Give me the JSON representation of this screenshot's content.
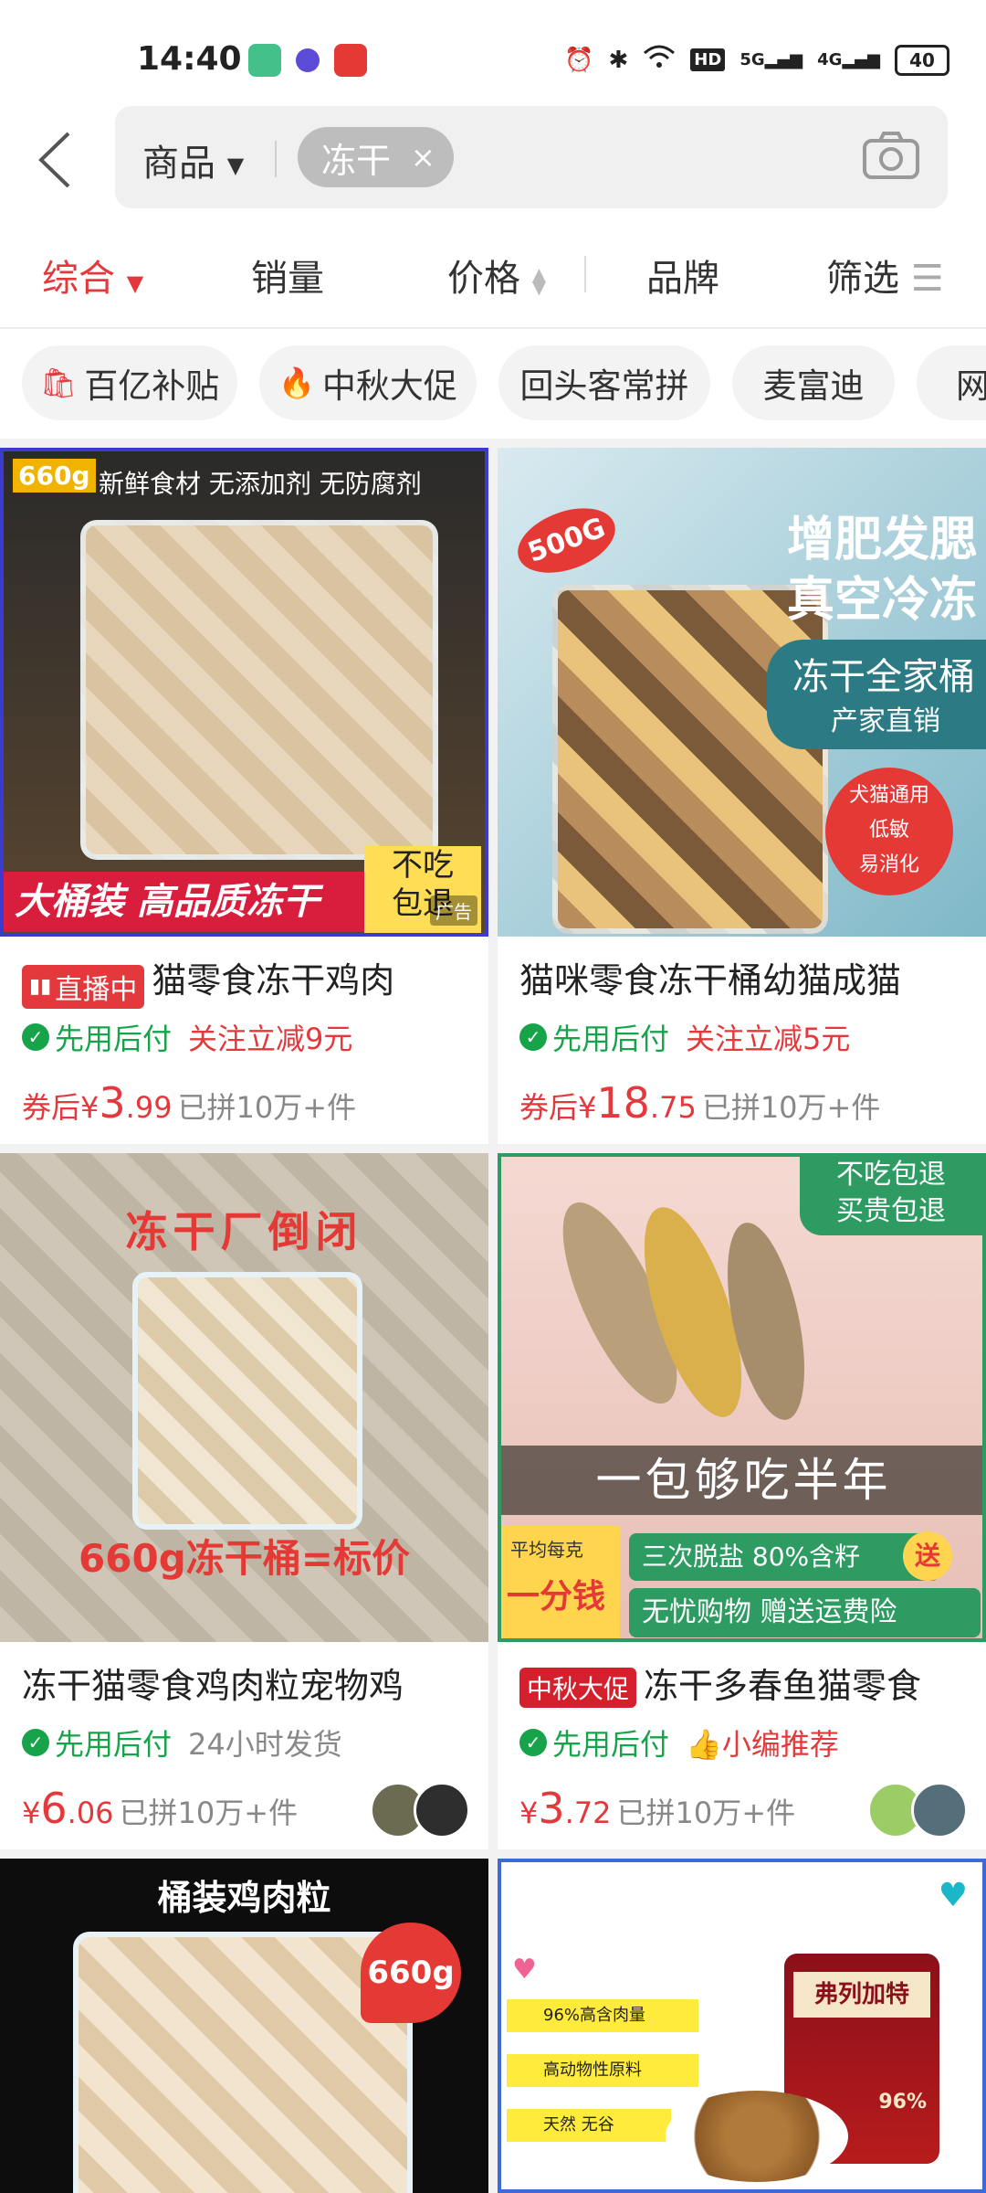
{
  "status": {
    "time": "14:40",
    "hd": "HD",
    "net1": "5G",
    "net2": "4G",
    "battery": "40"
  },
  "search": {
    "scope_label": "商品",
    "query": "冻干",
    "clear_icon": "×"
  },
  "sort": {
    "items": [
      "综合",
      "销量",
      "价格",
      "品牌",
      "筛选"
    ],
    "active": "综合"
  },
  "chips": [
    {
      "label": "百亿补贴",
      "icon": "bag-icon"
    },
    {
      "label": "中秋大促",
      "icon": "flame-icon"
    },
    {
      "label": "回头客常拼"
    },
    {
      "label": "麦富迪"
    },
    {
      "label": "网易"
    }
  ],
  "products": [
    {
      "img_text": {
        "weight": "660g",
        "banner": "新鲜食材 无添加剂 无防腐剂",
        "bottom": "大桶装 高品质冻干",
        "corner": "不吃\n包退",
        "ad": "广告"
      },
      "live_badge": "直播中",
      "title": "猫零食冻干鸡肉",
      "pay": "先用后付",
      "promo": "关注立减9元",
      "price_prefix": "券后¥",
      "price_int": "3",
      "price_dec": ".99",
      "sold": "已拼10万+件"
    },
    {
      "img_text": {
        "weight": "500G",
        "line1": "增肥发腮",
        "line2": "真空冷冻",
        "line3": "冻干全家桶",
        "line4": "产家直销",
        "circle": "犬猫通用\n低敏\n易消化"
      },
      "title": "猫咪零食冻干桶幼猫成猫",
      "pay": "先用后付",
      "promo": "关注立减5元",
      "price_prefix": "券后¥",
      "price_int": "18",
      "price_dec": ".75",
      "sold": "已拼10万+件"
    },
    {
      "img_text": {
        "top": "冻干厂倒闭",
        "bottom": "660g冻干桶=标价"
      },
      "title": "冻干猫零食鸡肉粒宠物鸡",
      "pay": "先用后付",
      "promo": "24小时发货",
      "price_prefix": "¥",
      "price_int": "6",
      "price_dec": ".06",
      "sold": "已拼10万+件"
    },
    {
      "img_text": {
        "corner": "不吃包退\n买贵包退",
        "middle": "一包够吃半年",
        "left_top": "平均每克",
        "left_big": "一分钱",
        "b1": "三次脱盐 80%含籽",
        "send": "送",
        "b2": "无忧购物 赠送运费险"
      },
      "promo_badge": "中秋大促",
      "title": "冻干多春鱼猫零食",
      "pay": "先用后付",
      "promo": "小编推荐",
      "price_prefix": "¥",
      "price_int": "3",
      "price_dec": ".72",
      "sold": "已拼10万+件"
    },
    {
      "img_text": {
        "top": "桶装鸡肉粒",
        "weight": "660g"
      }
    },
    {
      "img_text": {
        "f1": "96%高含肉量",
        "f2": "高动物性原料",
        "f3": "天然 无谷",
        "brand": "弗列加特",
        "sub": "96%"
      }
    }
  ],
  "colors": {
    "accent": "#e4393c",
    "green": "#16a34a"
  }
}
